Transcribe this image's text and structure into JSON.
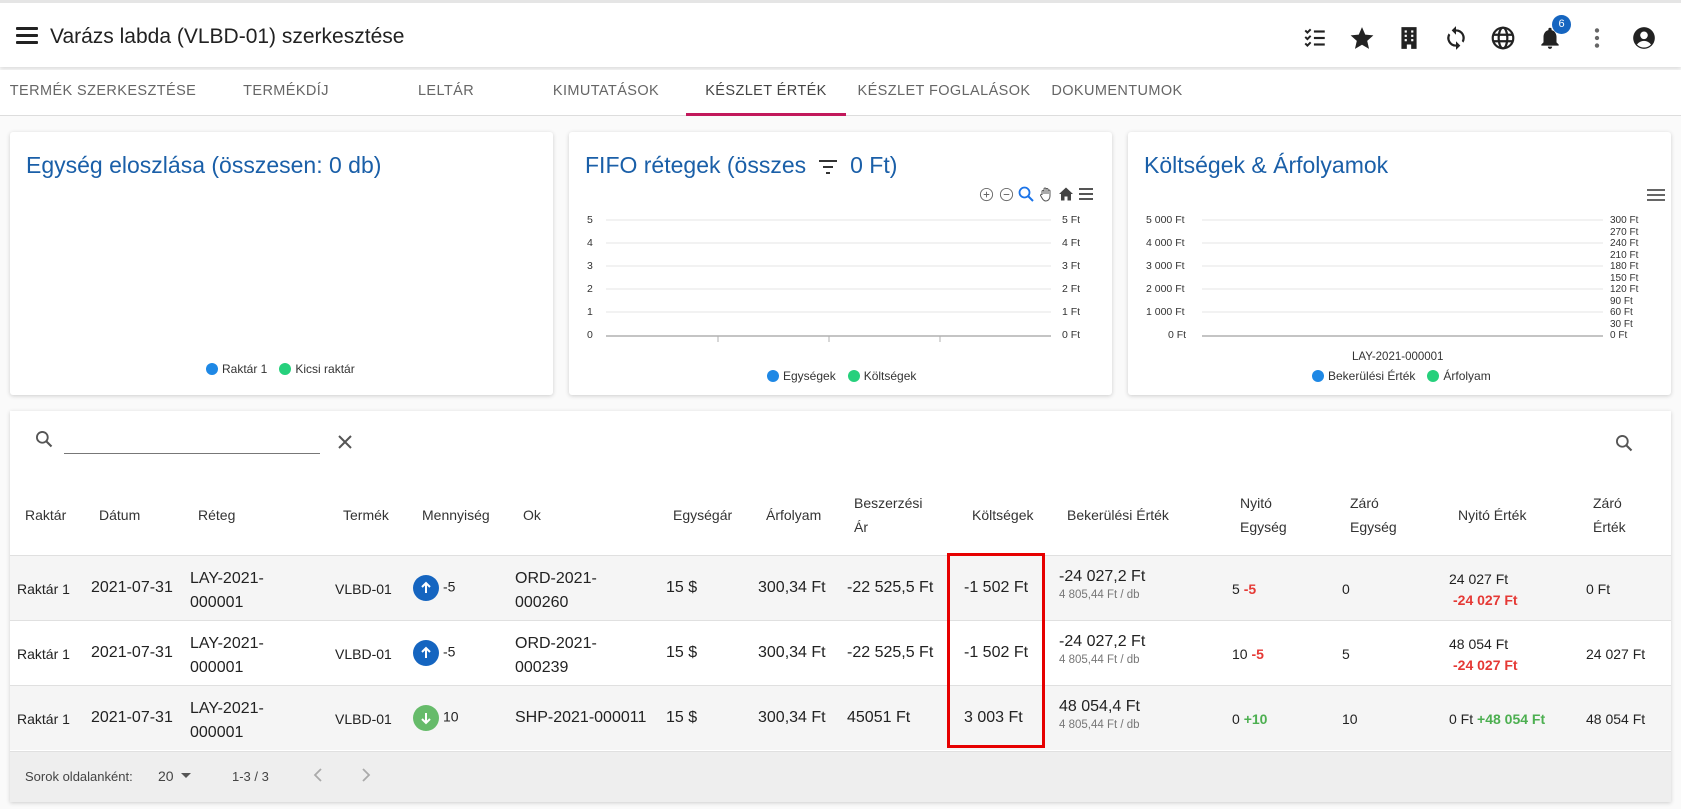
{
  "header": {
    "title": "Varázs labda (VLBD-01) szerkesztése",
    "notification_count": "6",
    "icons": [
      "menu-icon",
      "checklist-icon",
      "star-icon",
      "building-icon",
      "sync-icon",
      "globe-icon",
      "bell-icon",
      "more-vert-icon",
      "account-icon"
    ]
  },
  "tabs": [
    {
      "label": "Termék szerkesztése"
    },
    {
      "label": "Termékdíj"
    },
    {
      "label": "Leltár"
    },
    {
      "label": "Kimutatások"
    },
    {
      "label": "Készlet érték",
      "active": true
    },
    {
      "label": "Készlet foglalások"
    },
    {
      "label": "Dokumentumok"
    }
  ],
  "cards": {
    "units": {
      "title": "Egység eloszlása (összesen: 0 db)",
      "legend": [
        "Raktár 1",
        "Kicsi raktár"
      ]
    },
    "fifo": {
      "title_left": "FIFO rétegek (összes",
      "title_right": "0 Ft)",
      "legend": [
        "Egységek",
        "Költségek"
      ],
      "y_left": [
        "5",
        "4",
        "3",
        "2",
        "1",
        "0"
      ],
      "y_right": [
        "5 Ft",
        "4 Ft",
        "3 Ft",
        "2 Ft",
        "1 Ft",
        "0 Ft"
      ]
    },
    "costs": {
      "title": "Költségek & Árfolyamok",
      "legend": [
        "Bekerülési Érték",
        "Árfolyam"
      ],
      "y_left": [
        "5 000 Ft",
        "4 000 Ft",
        "3 000 Ft",
        "2 000 Ft",
        "1 000 Ft",
        "0 Ft"
      ],
      "y_right": [
        "300 Ft",
        "270 Ft",
        "240 Ft",
        "210 Ft",
        "180 Ft",
        "150 Ft",
        "120 Ft",
        "90 Ft",
        "60 Ft",
        "30 Ft",
        "0 Ft"
      ],
      "x_label": "LAY-2021-000001"
    }
  },
  "colors": {
    "blue": "#1e88e5",
    "green": "#26d07c",
    "accent": "#c2185b",
    "title_blue": "#1a5fa8",
    "highlight": "#e60000"
  },
  "table": {
    "search_value": "",
    "columns": {
      "raktar": "Raktár",
      "datum": "Dátum",
      "reteg": "Réteg",
      "termek": "Termék",
      "mennyiseg": "Mennyiség",
      "ok": "Ok",
      "egysegar": "Egységár",
      "arfolyam": "Árfolyam",
      "beszerzesi_1": "Beszerzési",
      "beszerzesi_2": "Ár",
      "koltsegek": "Költségek",
      "bekerulesi": "Bekerülési Érték",
      "nyito_egyseg_1": "Nyitó",
      "nyito_egyseg_2": "Egység",
      "zaro_egyseg_1": "Záró",
      "zaro_egyseg_2": "Egység",
      "nyito_ertek": "Nyitó Érték",
      "zaro_ertek_1": "Záró",
      "zaro_ertek_2": "Érték"
    },
    "rows": [
      {
        "raktar": "Raktár 1",
        "datum": "2021-07-31",
        "reteg_1": "LAY-2021-",
        "reteg_2": "000001",
        "termek": "VLBD-01",
        "direction": "up",
        "mennyiseg": "-5",
        "ok_1": "ORD-2021-",
        "ok_2": "000260",
        "egysegar": "15 $",
        "arfolyam": "300,34 Ft",
        "beszerzesi": "-22 525,5 Ft",
        "koltsegek": "-1 502 Ft",
        "bekerulesi": "-24 027,2 Ft",
        "bekerulesi_unit": "4 805,44 Ft / db",
        "nyito_egyseg": "5",
        "nyito_egyseg_delta": "-5",
        "zaro_egyseg": "0",
        "nyito_ertek": "24 027 Ft",
        "nyito_ertek_delta": "-24 027 Ft",
        "zaro_ertek": "0 Ft"
      },
      {
        "raktar": "Raktár 1",
        "datum": "2021-07-31",
        "reteg_1": "LAY-2021-",
        "reteg_2": "000001",
        "termek": "VLBD-01",
        "direction": "up",
        "mennyiseg": "-5",
        "ok_1": "ORD-2021-",
        "ok_2": "000239",
        "egysegar": "15 $",
        "arfolyam": "300,34 Ft",
        "beszerzesi": "-22 525,5 Ft",
        "koltsegek": "-1 502 Ft",
        "bekerulesi": "-24 027,2 Ft",
        "bekerulesi_unit": "4 805,44 Ft / db",
        "nyito_egyseg": "10",
        "nyito_egyseg_delta": "-5",
        "zaro_egyseg": "5",
        "nyito_ertek": "48 054 Ft",
        "nyito_ertek_delta": "-24 027 Ft",
        "zaro_ertek": "24 027 Ft"
      },
      {
        "raktar": "Raktár 1",
        "datum": "2021-07-31",
        "reteg_1": "LAY-2021-",
        "reteg_2": "000001",
        "termek": "VLBD-01",
        "direction": "down",
        "mennyiseg": "10",
        "ok_1": "SHP-2021-000011",
        "ok_2": "",
        "egysegar": "15 $",
        "arfolyam": "300,34 Ft",
        "beszerzesi": "45051 Ft",
        "koltsegek": "3 003 Ft",
        "bekerulesi": "48 054,4 Ft",
        "bekerulesi_unit": "4 805,44 Ft / db",
        "nyito_egyseg": "0",
        "nyito_egyseg_delta": "+10",
        "zaro_egyseg": "10",
        "nyito_ertek": "0 Ft",
        "nyito_ertek_delta": "+48 054 Ft",
        "zaro_ertek": "48 054 Ft"
      }
    ],
    "footer": {
      "rows_per_page_label": "Sorok oldalanként:",
      "rows_per_page": "20",
      "range": "1-3 / 3"
    }
  }
}
